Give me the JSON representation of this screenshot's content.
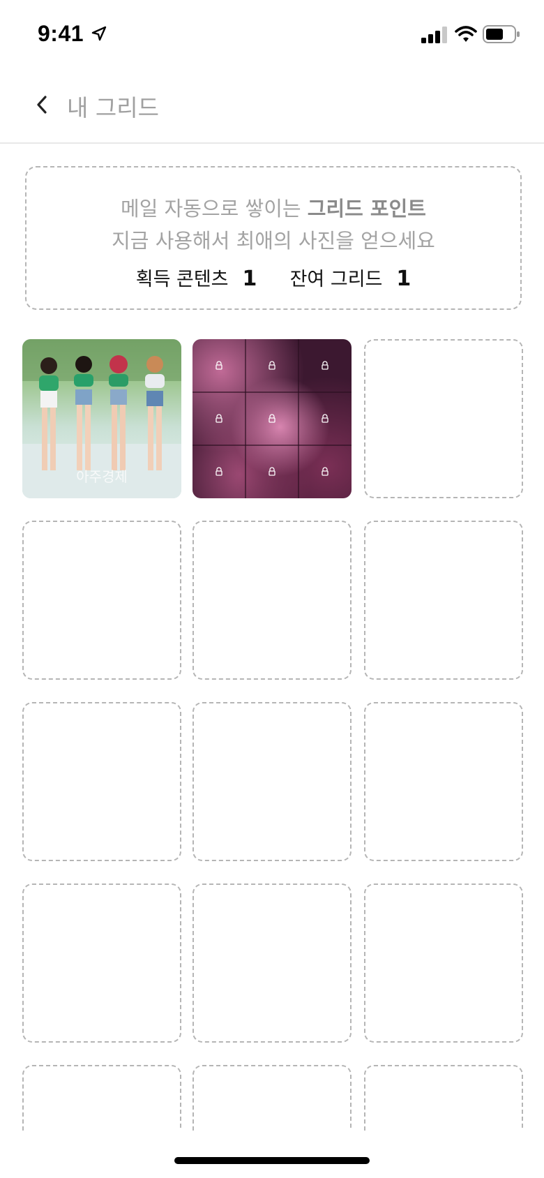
{
  "status_bar": {
    "time": "9:41"
  },
  "nav": {
    "title": "내 그리드"
  },
  "info": {
    "line1_prefix": "메일 자동으로 쌓이는 ",
    "line1_bold": "그리드 포인트",
    "line2": "지금 사용해서 최애의 사진을 얻으세요",
    "acquired_label": "획득 콘텐츠",
    "acquired_value": "1",
    "remaining_label": "잔여 그리드",
    "remaining_value": "1"
  },
  "grid": {
    "photo_caption": "아주경제"
  },
  "colors": {
    "border_dashed": "#b5b5b5",
    "muted_text": "#a3a3a3"
  }
}
